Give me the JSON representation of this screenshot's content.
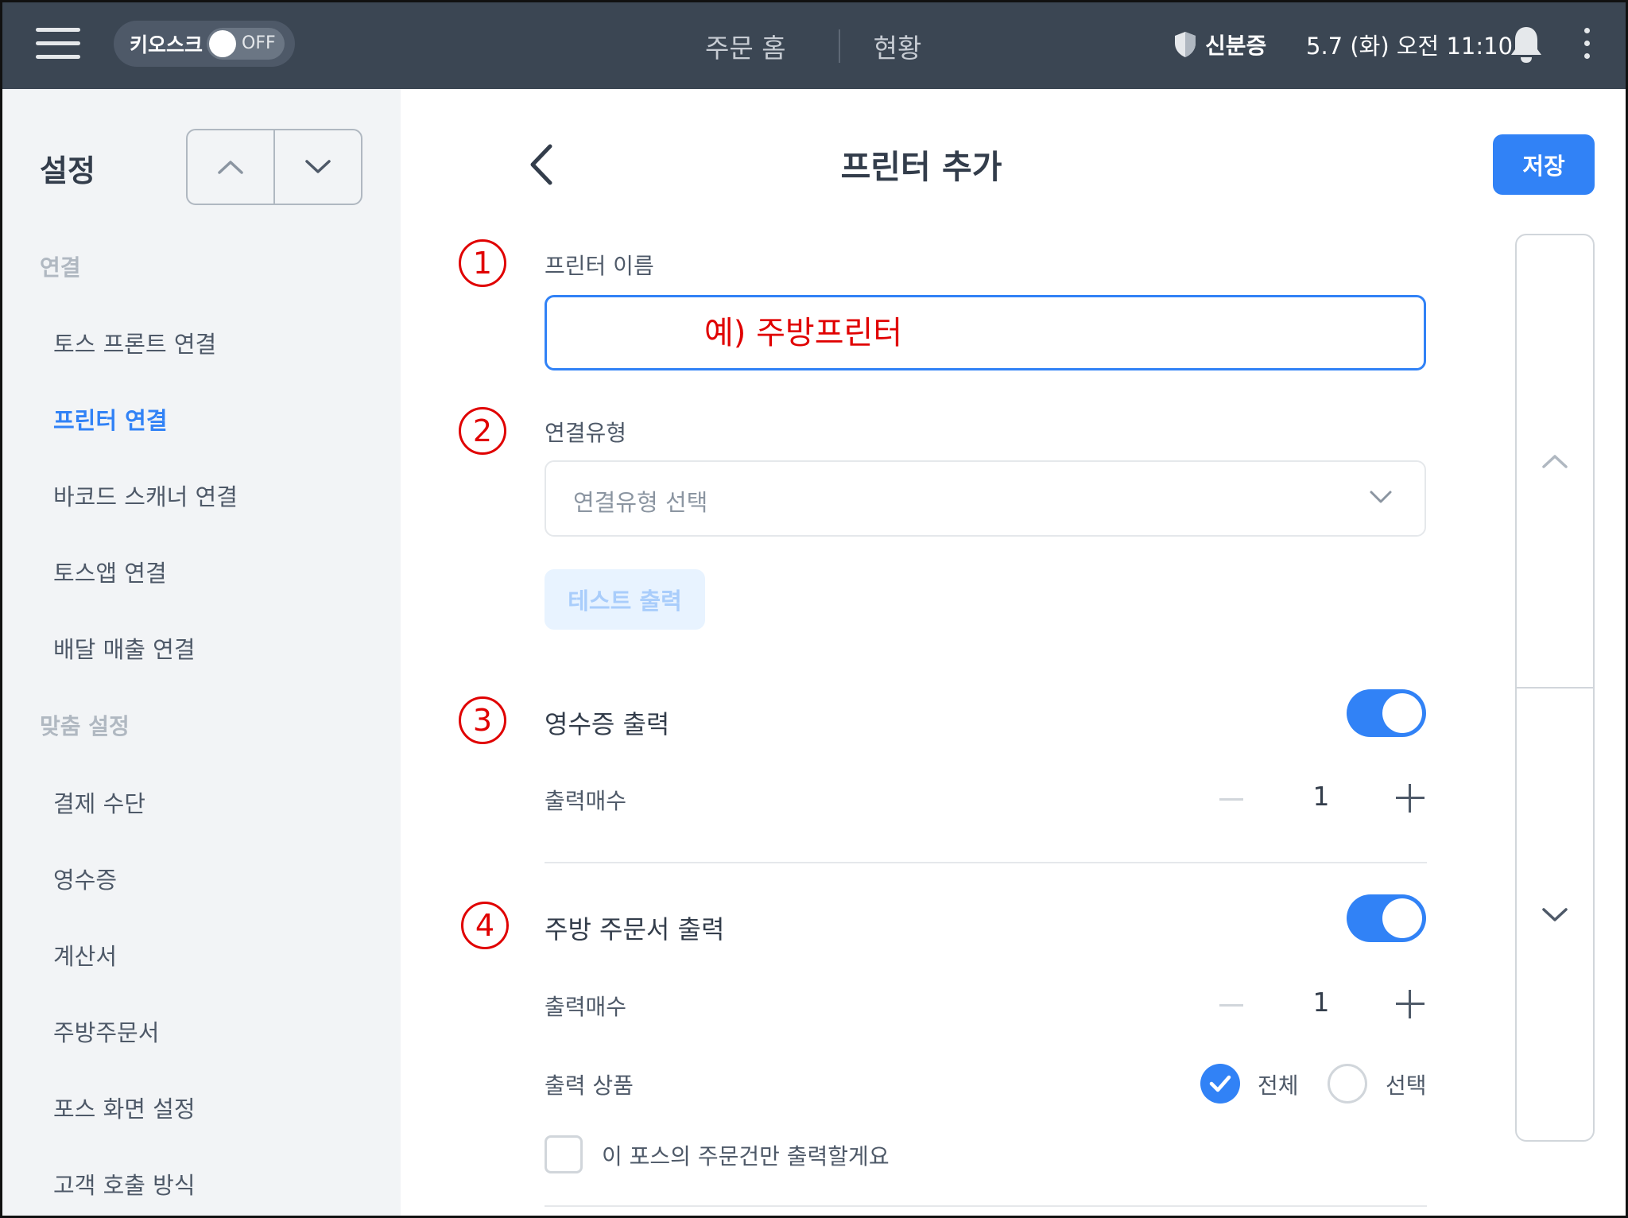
{
  "topbar": {
    "kiosk_label": "키오스크",
    "kiosk_state": "OFF",
    "nav": [
      "주문 홈",
      "현황"
    ],
    "id_label": "신분증",
    "datetime": "5.7 (화) 오전 11:10"
  },
  "sidebar": {
    "title": "설정",
    "sections": [
      {
        "label": "연결",
        "items": [
          "토스 프론트 연결",
          "프린터 연결",
          "바코드 스캐너 연결",
          "토스앱 연결",
          "배달 매출 연결"
        ]
      },
      {
        "label": "맞춤 설정",
        "items": [
          "결제 수단",
          "영수증",
          "계산서",
          "주방주문서",
          "포스 화면 설정",
          "고객 호출 방식"
        ]
      }
    ],
    "active_item": "프린터 연결"
  },
  "main": {
    "title": "프린터 추가",
    "save_label": "저장",
    "annotations": [
      "1",
      "2",
      "3",
      "4"
    ],
    "printer_name": {
      "label": "프린터 이름",
      "placeholder": "예) 주방프린터"
    },
    "connection_type": {
      "label": "연결유형",
      "value": "연결유형 선택"
    },
    "test_print_label": "테스트 출력",
    "receipt": {
      "title": "영수증 출력",
      "enabled": true,
      "copies_label": "출력매수",
      "copies": "1"
    },
    "kitchen": {
      "title": "주방 주문서 출력",
      "enabled": true,
      "copies_label": "출력매수",
      "copies": "1",
      "products_label": "출력 상품",
      "option_all": "전체",
      "option_select": "선택",
      "selected": "전체",
      "only_this_pos": "이 포스의 주문건만 출력할게요"
    }
  },
  "colors": {
    "accent": "#3182f6",
    "topbar": "#3b4653",
    "sidebar_bg": "#f2f4f6",
    "annotation_red": "#e00000"
  }
}
